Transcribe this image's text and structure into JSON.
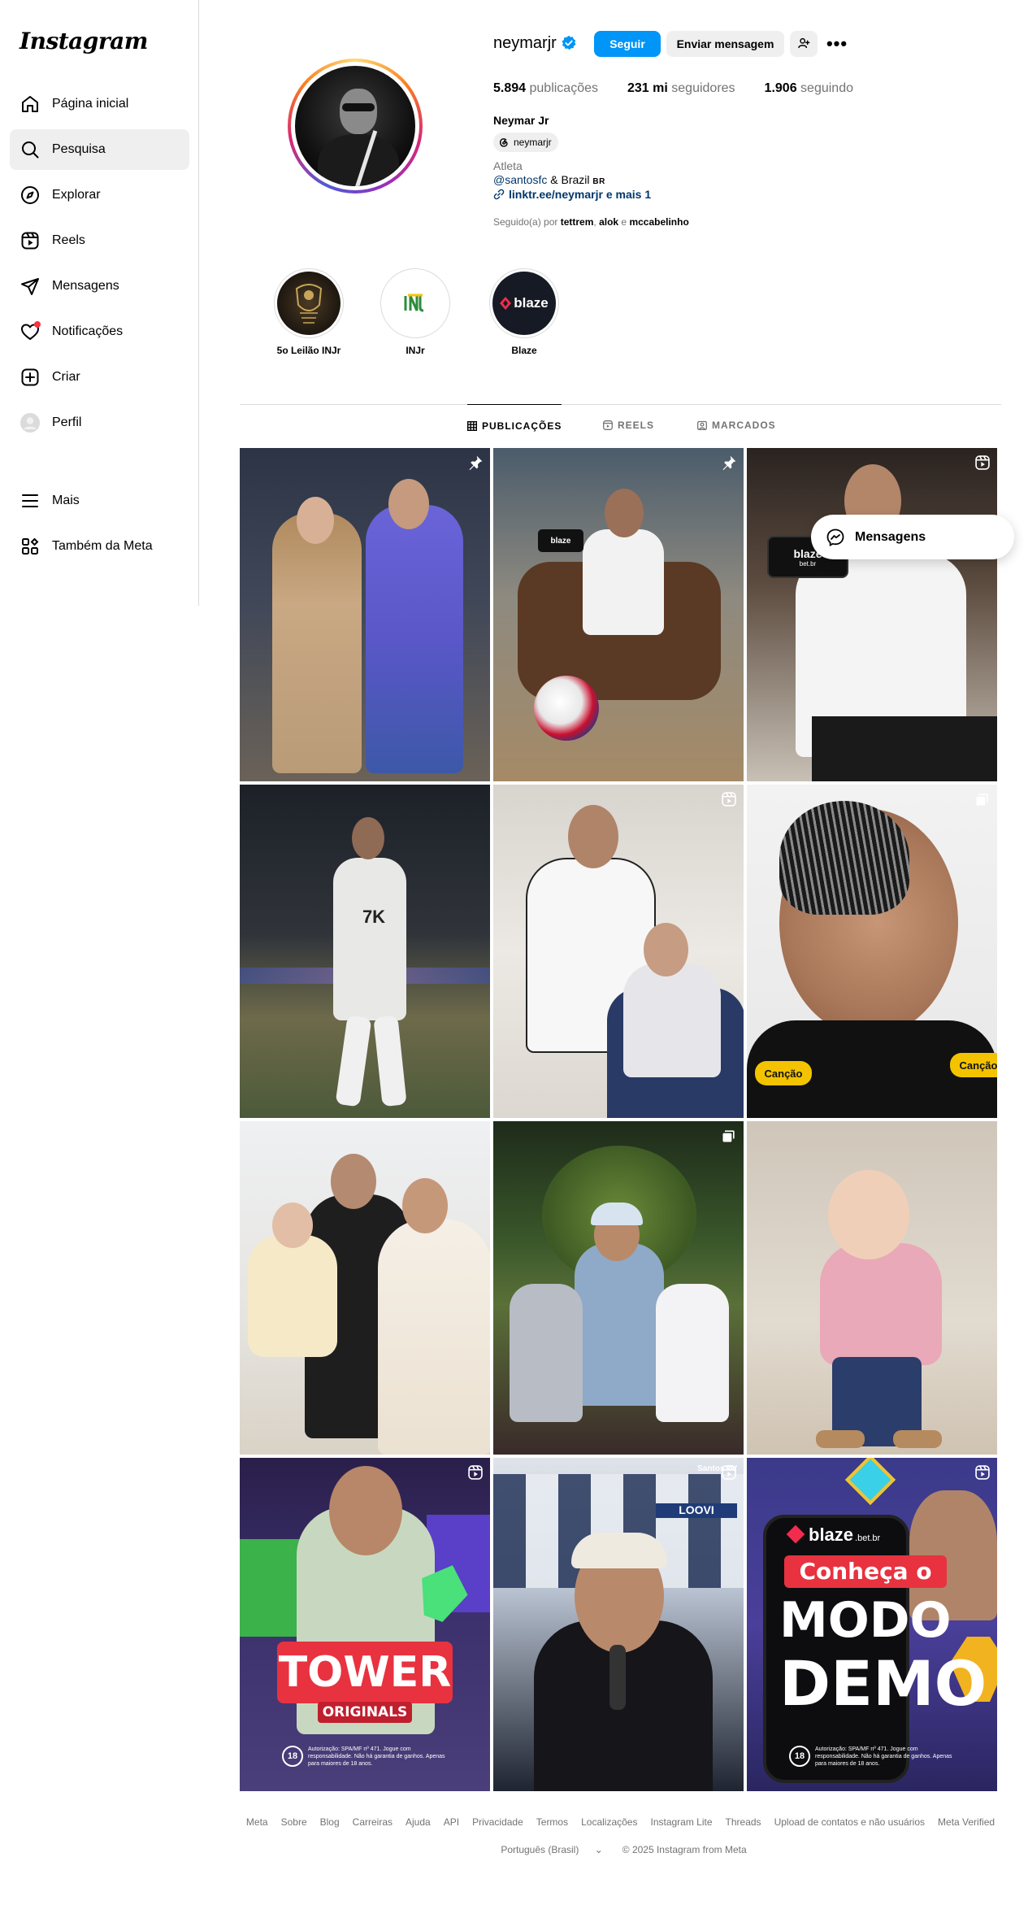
{
  "app": {
    "logo": "Instagram"
  },
  "sidebar": {
    "items": [
      {
        "label": "Página inicial",
        "icon": "home-icon"
      },
      {
        "label": "Pesquisa",
        "icon": "search-icon"
      },
      {
        "label": "Explorar",
        "icon": "compass-icon"
      },
      {
        "label": "Reels",
        "icon": "reels-icon"
      },
      {
        "label": "Mensagens",
        "icon": "paper-plane-icon"
      },
      {
        "label": "Notificações",
        "icon": "heart-icon"
      },
      {
        "label": "Criar",
        "icon": "plus-square-icon"
      },
      {
        "label": "Perfil",
        "icon": "avatar-icon"
      },
      {
        "label": "Mais",
        "icon": "menu-icon"
      },
      {
        "label": "Também da Meta",
        "icon": "meta-apps-icon"
      }
    ],
    "active_index": 1
  },
  "profile": {
    "username": "neymarjr",
    "verified": true,
    "follow_label": "Seguir",
    "message_label": "Enviar mensagem",
    "more_label": "•••",
    "stats": {
      "posts_value": "5.894",
      "posts_label": "publicações",
      "followers_value": "231 mi",
      "followers_label": "seguidores",
      "following_value": "1.906",
      "following_label": "seguindo"
    },
    "full_name": "Neymar Jr",
    "threads_handle": "neymarjr",
    "category": "Atleta",
    "bio_mention": "@santosfc",
    "bio_rest": " & Brazil ",
    "bio_flag": "BR",
    "link": "linktr.ee/neymarjr e mais 1",
    "followed_by_prefix": "Seguido(a) por ",
    "followed_by_1": "tettrem",
    "followed_by_sep": ", ",
    "followed_by_2": "alok",
    "followed_by_and": " e ",
    "followed_by_3": "mccabelinho"
  },
  "highlights": [
    {
      "label": "5o Leilão INJr"
    },
    {
      "label": "INJr"
    },
    {
      "label": "Blaze",
      "text": "blaze"
    }
  ],
  "tabs": [
    {
      "label": "PUBLICAÇÕES",
      "icon": "grid-icon",
      "active": true
    },
    {
      "label": "REELS",
      "icon": "reels-icon",
      "active": false
    },
    {
      "label": "MARCADOS",
      "icon": "tagged-icon",
      "active": false
    }
  ],
  "posts": [
    {
      "badge": "pin-icon"
    },
    {
      "badge": "pin-icon",
      "sign": "blaze"
    },
    {
      "badge": "reel-icon",
      "phone_text": "blaze",
      "phone_sub": "bet.br"
    },
    {
      "badge": "",
      "shirt_text": "7K"
    },
    {
      "badge": "reel-icon"
    },
    {
      "badge": "carousel-icon",
      "patch_1": "Canção",
      "patch_2": "Canção"
    },
    {
      "badge": ""
    },
    {
      "badge": "carousel-icon"
    },
    {
      "badge": ""
    },
    {
      "badge": "reel-icon",
      "title": "TOWER",
      "subtitle": "ORIGINALS",
      "age": "18",
      "disclaimer": "Autorização: SPA/MF nº 471. Jogue com responsabilidade. Não há garantia de ganhos. Apenas para maiores de 18 anos."
    },
    {
      "badge": "reel-icon",
      "tv": "Santos TV",
      "sponsor": "LOOVI"
    },
    {
      "badge": "reel-icon",
      "brand": "blaze",
      "brand_sub": ".bet.br",
      "line1": "Conheça o",
      "line2": "MODO",
      "line3": "DEMO",
      "age": "18",
      "disclaimer": "Autorização: SPA/MF nº 471. Jogue com responsabilidade. Não há garantia de ganhos. Apenas para maiores de 18 anos."
    }
  ],
  "messages_pill": {
    "label": "Mensagens"
  },
  "footer": {
    "links": [
      "Meta",
      "Sobre",
      "Blog",
      "Carreiras",
      "Ajuda",
      "API",
      "Privacidade",
      "Termos",
      "Localizações",
      "Instagram Lite",
      "Threads",
      "Upload de contatos e não usuários",
      "Meta Verified"
    ],
    "language": "Português (Brasil)",
    "copyright": "© 2025 Instagram from Meta"
  },
  "colors": {
    "primary_button": "#0095f6",
    "secondary_button": "#efefef",
    "link": "#00376b",
    "muted_text": "#737373",
    "border": "#dbdbdb",
    "notification_dot": "#ff3040"
  }
}
